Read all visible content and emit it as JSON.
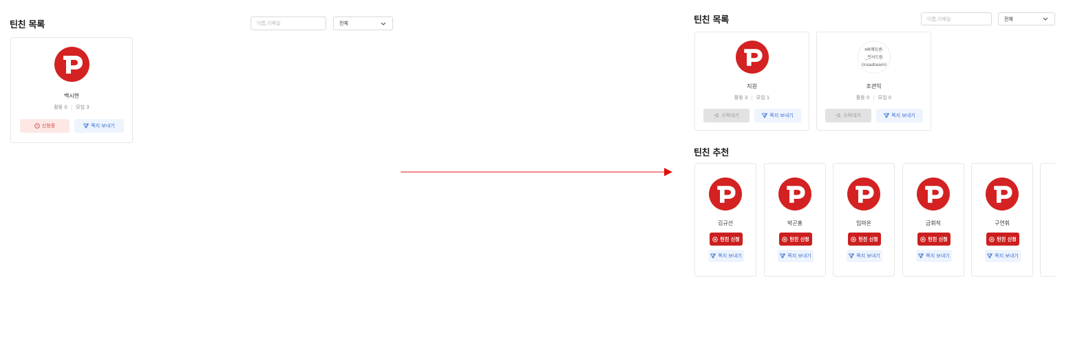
{
  "left": {
    "title": "틴친 목록",
    "search_placeholder": "이름,이메일",
    "filter_value": "전체",
    "card": {
      "name": "백시현",
      "activity_label": "활동",
      "activity_count": "0",
      "meeting_label": "모임",
      "meeting_count": "3",
      "pending_label": "신청중",
      "message_label": "쪽지 보내기"
    }
  },
  "right": {
    "list_title": "틴친 목록",
    "search_placeholder": "이름,이메일",
    "filter_value": "전체",
    "cards": [
      {
        "name": "지원",
        "activity": "활동 3",
        "meeting": "모임 1",
        "wait_label": "수락대기",
        "message_label": "쪽지 보내기"
      },
      {
        "name": "조관익",
        "avatar_text": "HR에듀센-\n_인사드림\n(insadream)",
        "activity": "활동 0",
        "meeting": "모임 0",
        "wait_label": "수락대기",
        "message_label": "쪽지 보내기"
      }
    ],
    "recommend_title": "틴친 추천",
    "recommendations": [
      {
        "name": "김규선",
        "apply_label": "틴친 신청",
        "message_label": "쪽지 보내기"
      },
      {
        "name": "박곤홍",
        "apply_label": "틴친 신청",
        "message_label": "쪽지 보내기"
      },
      {
        "name": "임마온",
        "apply_label": "틴친 신청",
        "message_label": "쪽지 보내기"
      },
      {
        "name": "금휘직",
        "apply_label": "틴친 신청",
        "message_label": "쪽지 보내기"
      },
      {
        "name": "구연휘",
        "apply_label": "틴친 신청",
        "message_label": "쪽지 보내기"
      }
    ]
  },
  "icons": {
    "avatar": "p-logo-icon",
    "chevron": "chevron-down-icon",
    "pending": "alert-circle-icon",
    "message": "send-icon",
    "wait": "user-plus-icon",
    "apply": "plus-circle-icon"
  },
  "colors": {
    "brand_red": "#d42121",
    "apply_red": "#cc1f1f",
    "pending_bg": "#fde8e6",
    "message_bg": "#eef4fd",
    "message_text": "#3b6fd1",
    "arrow": "#e01010"
  }
}
